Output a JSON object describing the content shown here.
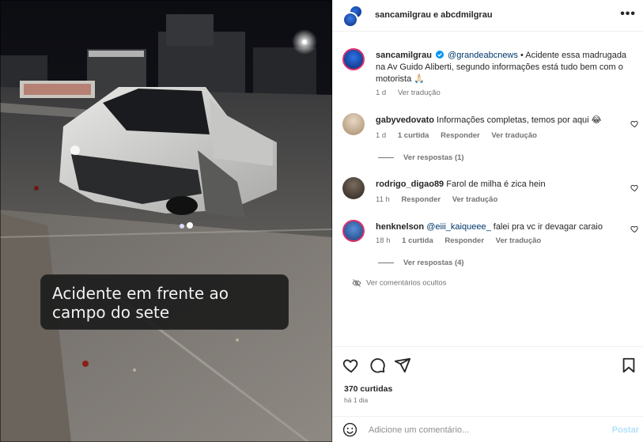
{
  "post": {
    "media_text": "Acidente em frente ao campo do sete"
  },
  "header": {
    "title": "sancamilgrau e abcdmilgrau",
    "more_label": "•••"
  },
  "caption": {
    "username": "sancamilgrau",
    "mention": "@grandeabcnews",
    "text": " • Acidente essa madrugada na Av Guido Aliberti, segundo informações está tudo bem com o motorista 🙏🏻",
    "time": "1 d",
    "translate": "Ver tradução"
  },
  "comments": [
    {
      "username": "gabyvedovato",
      "text": "Informações completas, temos por aqui 😂",
      "time": "1 d",
      "likes": "1 curtida",
      "reply": "Responder",
      "translate": "Ver tradução",
      "replies_label": "Ver respostas (1)"
    },
    {
      "username": "rodrigo_digao89",
      "text": "Farol de milha é zica hein",
      "time": "11 h",
      "reply": "Responder",
      "translate": "Ver tradução"
    },
    {
      "username": "henknelson",
      "mention": "@eiii_kaiqueee_",
      "text": " falei pra vc ir devagar caraio",
      "time": "18 h",
      "likes": "1 curtida",
      "reply": "Responder",
      "translate": "Ver tradução",
      "replies_label": "Ver respostas (4)"
    }
  ],
  "hidden_comments_label": "Ver comentários ocultos",
  "actions": {
    "icons": [
      "heart-icon",
      "comment-icon",
      "share-icon",
      "bookmark-icon"
    ],
    "likes": "370 curtidas",
    "date": "há 1 dia"
  },
  "add_comment": {
    "placeholder": "Adicione um comentário...",
    "post_label": "Postar"
  },
  "colors": {
    "mention": "#00376b",
    "muted": "#737373",
    "post_disabled": "#b2dffc",
    "verified": "#0095f6"
  }
}
